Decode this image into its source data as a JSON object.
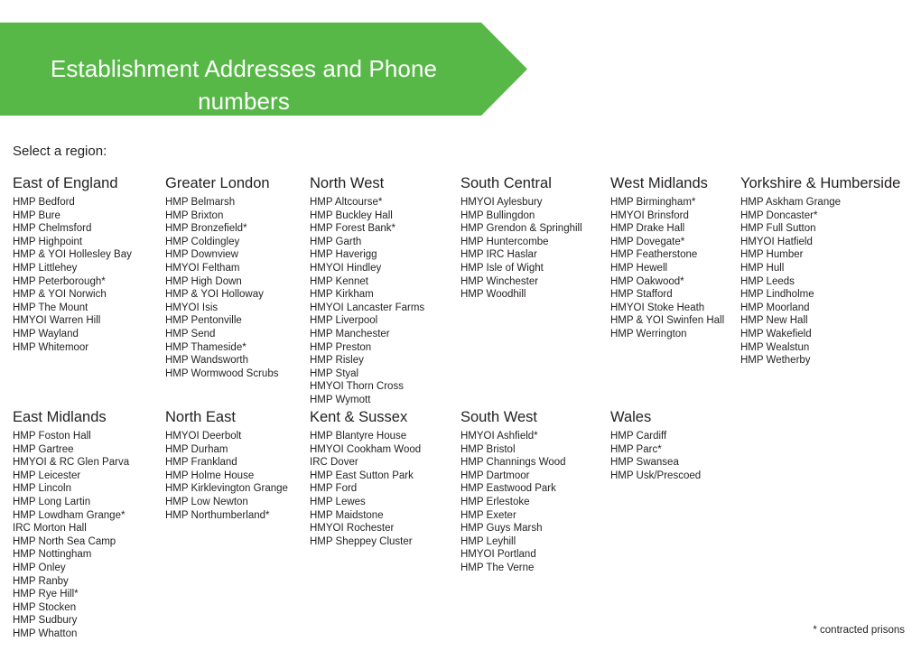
{
  "banner": {
    "title": "Establishment Addresses and Phone\nnumbers",
    "color": "#57b847",
    "shape": "pentagon-arrow-right"
  },
  "select_region_label": "Select a region:",
  "footnote": "* contracted prisons",
  "sections": [
    {
      "name": "top-row",
      "columns": [
        {
          "title": "East of England",
          "items": [
            "HMP Bedford",
            "HMP Bure",
            "HMP Chelmsford",
            "HMP Highpoint",
            "HMP & YOI Hollesley Bay",
            "HMP Littlehey",
            "HMP Peterborough*",
            "HMP & YOI Norwich",
            "HMP The Mount",
            "HMYOI Warren Hill",
            "HMP Wayland",
            "HMP Whitemoor"
          ]
        },
        {
          "title": "Greater London",
          "items": [
            "HMP Belmarsh",
            "HMP Brixton",
            "HMP Bronzefield*",
            "HMP Coldingley",
            "HMP Downview",
            "HMYOI Feltham",
            "HMP High Down",
            "HMP & YOI Holloway",
            "HMYOI Isis",
            "HMP Pentonville",
            "HMP Send",
            "HMP Thameside*",
            "HMP Wandsworth",
            "HMP Wormwood Scrubs"
          ]
        },
        {
          "title": "North West",
          "items": [
            "HMP Altcourse*",
            "HMP Buckley Hall",
            "HMP Forest Bank*",
            "HMP Garth",
            "HMP Haverigg",
            "HMYOI Hindley",
            "HMP Kennet",
            "HMP Kirkham",
            "HMYOI Lancaster Farms",
            "HMP Liverpool",
            "HMP Manchester",
            "HMP Preston",
            "HMP Risley",
            "HMP Styal",
            "HMYOI Thorn Cross",
            "HMP Wymott"
          ]
        },
        {
          "title": "South Central",
          "items": [
            "HMYOI Aylesbury",
            "HMP Bullingdon",
            "HMP Grendon & Springhill",
            "HMP Huntercombe",
            "HMP IRC Haslar",
            "HMP Isle of Wight",
            "HMP Winchester",
            "HMP Woodhill"
          ]
        },
        {
          "title": "West Midlands",
          "items": [
            "HMP Birmingham*",
            "HMYOI Brinsford",
            "HMP Drake Hall",
            "HMP Dovegate*",
            "HMP Featherstone",
            "HMP Hewell",
            "HMP Oakwood*",
            "HMP Stafford",
            "HMYOI Stoke Heath",
            "HMP & YOI Swinfen Hall",
            "HMP Werrington"
          ]
        },
        {
          "title": "Yorkshire & Humberside",
          "items": [
            "HMP Askham Grange",
            "HMP Doncaster*",
            "HMP Full Sutton",
            "HMYOI Hatfield",
            "HMP Humber",
            "HMP Hull",
            "HMP Leeds",
            "HMP Lindholme",
            "HMP Moorland",
            "HMP New Hall",
            "HMP Wakefield",
            "HMP Wealstun",
            "HMP Wetherby"
          ]
        }
      ]
    },
    {
      "name": "bottom-row",
      "columns": [
        {
          "title": "East Midlands",
          "items": [
            "HMP Foston Hall",
            "HMP Gartree",
            "HMYOI & RC Glen Parva",
            "HMP Leicester",
            "HMP Lincoln",
            "HMP Long Lartin",
            "HMP Lowdham Grange*",
            "IRC Morton Hall",
            "HMP North Sea Camp",
            "HMP Nottingham",
            "HMP Onley",
            "HMP Ranby",
            "HMP Rye Hill*",
            "HMP Stocken",
            "HMP Sudbury",
            "HMP Whatton"
          ]
        },
        {
          "title": "North East",
          "items": [
            "HMYOI Deerbolt",
            "HMP Durham",
            "HMP Frankland",
            "HMP Holme House",
            "HMP Kirklevington Grange",
            "HMP Low Newton",
            "HMP Northumberland*"
          ]
        },
        {
          "title": "Kent & Sussex",
          "items": [
            "HMP Blantyre House",
            "HMYOI Cookham Wood",
            "IRC Dover",
            "HMP East Sutton Park",
            "HMP Ford",
            "HMP Lewes",
            "HMP Maidstone",
            "HMYOI Rochester",
            "HMP Sheppey Cluster"
          ]
        },
        {
          "title": "South West",
          "items": [
            "HMYOI Ashfield*",
            "HMP Bristol",
            "HMP Channings Wood",
            "HMP Dartmoor",
            "HMP Eastwood Park",
            "HMP Erlestoke",
            "HMP Exeter",
            "HMP Guys Marsh",
            "HMP Leyhill",
            "HMYOI Portland",
            "HMP The Verne"
          ]
        },
        {
          "title": "Wales",
          "items": [
            "HMP Cardiff",
            "HMP Parc*",
            "HMP Swansea",
            "HMP Usk/Prescoed"
          ]
        }
      ]
    }
  ]
}
